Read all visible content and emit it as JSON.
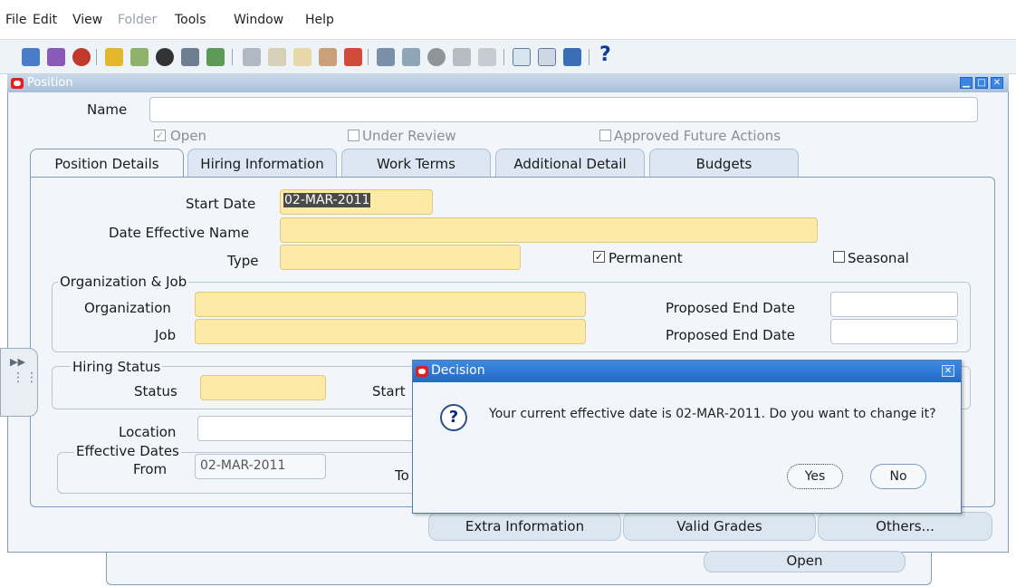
{
  "menu": {
    "file": "File",
    "edit": "Edit",
    "view": "View",
    "folder": "Folder",
    "tools": "Tools",
    "window": "Window",
    "help": "Help"
  },
  "toolbar": {
    "help_glyph": "?"
  },
  "window": {
    "title": "Position"
  },
  "header": {
    "name_label": "Name",
    "name_value": "",
    "open_label": "Open",
    "open_checked": true,
    "under_review_label": "Under Review",
    "under_review_checked": false,
    "approved_label": "Approved Future Actions",
    "approved_checked": false
  },
  "tabs": [
    {
      "label": "Position Details",
      "active": true
    },
    {
      "label": "Hiring Information",
      "active": false
    },
    {
      "label": "Work Terms",
      "active": false
    },
    {
      "label": "Additional Detail",
      "active": false
    },
    {
      "label": "Budgets",
      "active": false
    }
  ],
  "details": {
    "start_date_label": "Start Date",
    "start_date_value": "02-MAR-2011",
    "date_effective_name_label": "Date Effective Name",
    "date_effective_name_value": "",
    "type_label": "Type",
    "type_value": "",
    "permanent_label": "Permanent",
    "permanent_checked": true,
    "seasonal_label": "Seasonal",
    "seasonal_checked": false
  },
  "org_job": {
    "legend": "Organization & Job",
    "organization_label": "Organization",
    "job_label": "Job",
    "proposed_end_date_label": "Proposed End Date",
    "proposed_end_date_label_2": "Proposed End Date"
  },
  "hiring": {
    "legend": "Hiring Status",
    "status_label": "Status",
    "start_label": "Start"
  },
  "location": {
    "label": "Location"
  },
  "effective_dates": {
    "legend": "Effective Dates",
    "from_label": "From",
    "from_value": "02-MAR-2011",
    "to_label": "To"
  },
  "bottom_buttons": {
    "extra_information": "Extra Information",
    "valid_grades": "Valid Grades",
    "others": "Others...",
    "open": "Open"
  },
  "dialog": {
    "title": "Decision",
    "message": "Your current effective date is 02-MAR-2011. Do you want to change it?",
    "yes": "Yes",
    "no": "No"
  },
  "colors": {
    "required_field": "#fdeaa6",
    "titlebar_active": "#2568c9",
    "oracle_red": "#e0201b"
  }
}
